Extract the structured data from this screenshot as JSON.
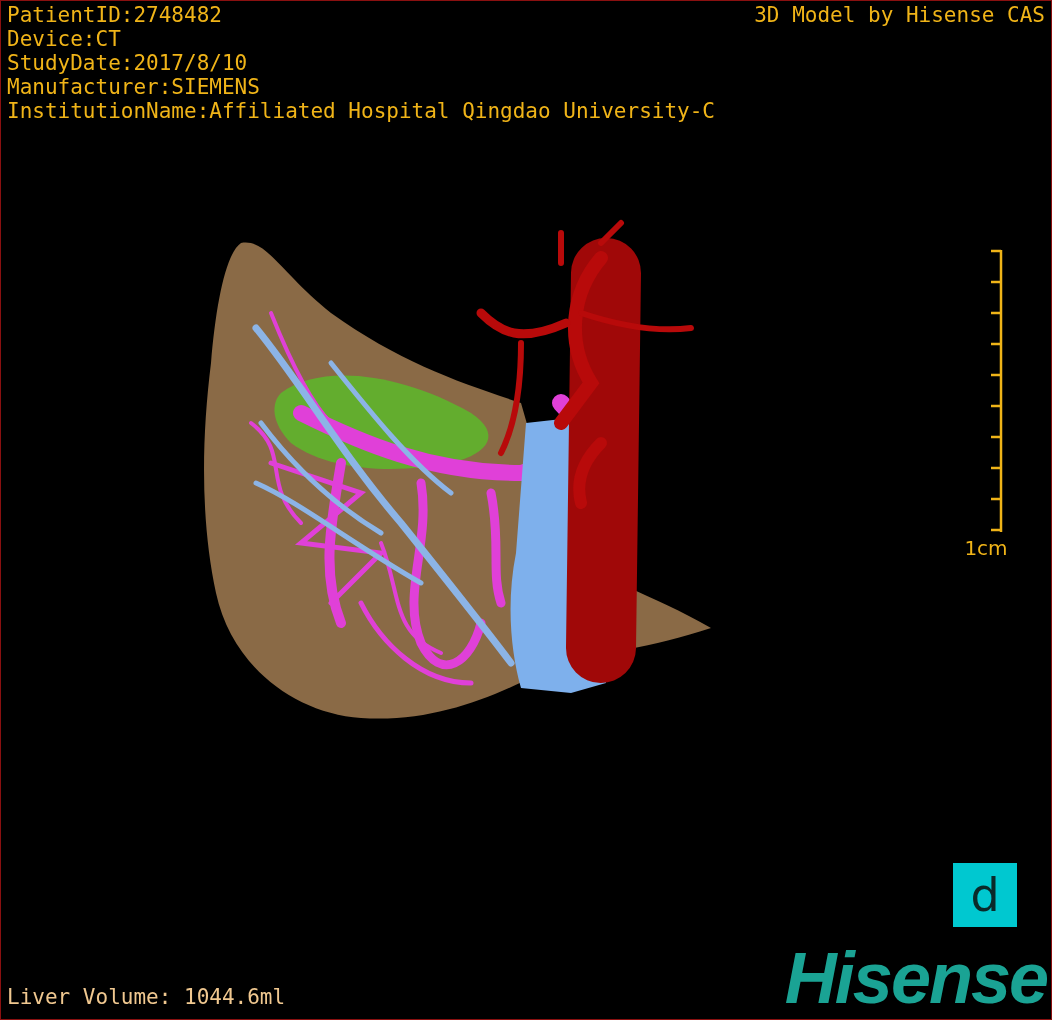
{
  "patient_info": [
    "PatientID:2748482",
    "Device:CT",
    "StudyDate:2017/8/10",
    "Manufacturer:SIEMENS",
    "InstitutionName:Affiliated Hospital Qingdao University-C"
  ],
  "credit": "3D Model by Hisense CAS",
  "scale_bar": {
    "label": "1cm"
  },
  "liver_volume": "Liver Volume: 1044.6ml",
  "view_button": "d",
  "logo": "Hisense"
}
